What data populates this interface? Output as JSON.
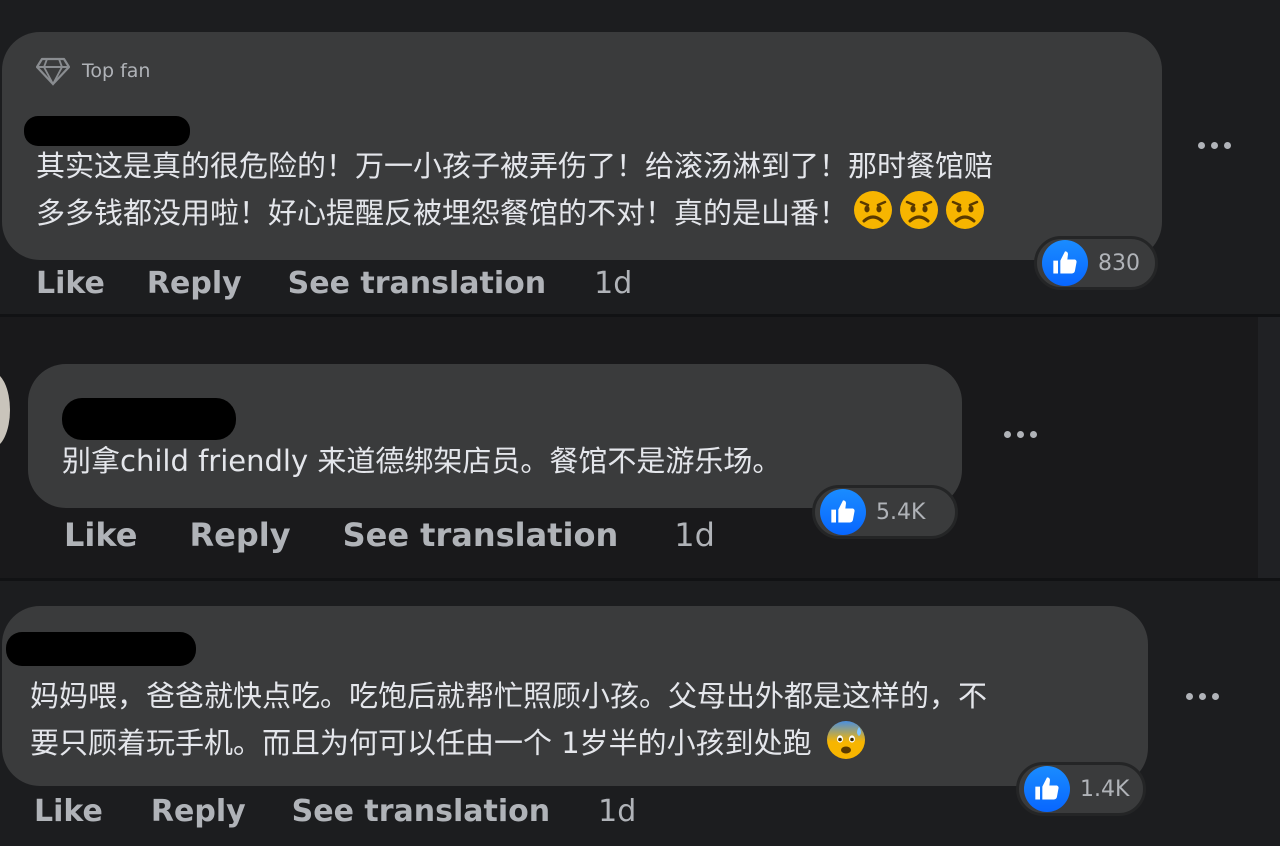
{
  "comments": [
    {
      "badge": "Top fan",
      "text_line1": "其实这是真的很危险的！万一小孩子被弄伤了！给滚汤淋到了！那时餐馆赔",
      "text_line2": "多多钱都没用啦！好心提醒反被埋怨餐馆的不对！真的是山番！",
      "emoji": [
        "frowning-face-icon",
        "frowning-face-icon",
        "frowning-face-icon"
      ],
      "reaction_count": "830",
      "like_label": "Like",
      "reply_label": "Reply",
      "translate_label": "See translation",
      "time": "1d"
    },
    {
      "text_line1": "别拿child friendly 来道德绑架店员。餐馆不是游乐场。",
      "reaction_count": "5.4K",
      "like_label": "Like",
      "reply_label": "Reply",
      "translate_label": "See translation",
      "time": "1d"
    },
    {
      "text_line1": "妈妈喂，爸爸就快点吃。吃饱后就帮忙照顾小孩。父母出外都是这样的，不",
      "text_line2": "要只顾着玩手机。而且为何可以任由一个 1岁半的小孩到处跑",
      "emoji": [
        "anxious-sweat-face-icon"
      ],
      "reaction_count": "1.4K",
      "like_label": "Like",
      "reply_label": "Reply",
      "translate_label": "See translation",
      "time": "1d"
    }
  ],
  "colors": {
    "background": "#18191a",
    "bubble": "#3a3b3c",
    "text": "#e4e6eb",
    "secondary_text": "#b0b3b8",
    "like_blue": "#0866ff"
  }
}
